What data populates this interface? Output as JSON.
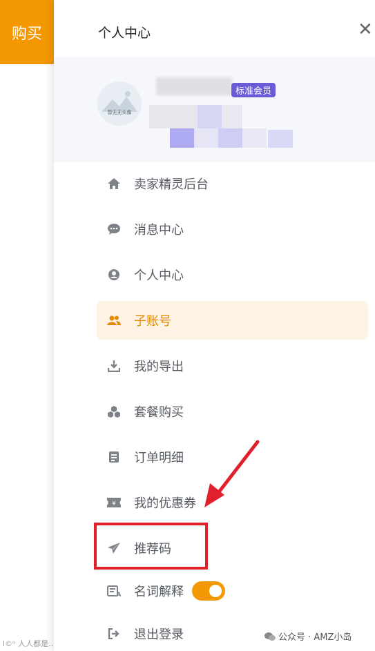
{
  "left_panel": {
    "buy_label": "购买",
    "watermark": "l©ᵒ 人人都是…"
  },
  "drawer": {
    "title": "个人中心",
    "close_symbol": "✕",
    "profile": {
      "member_badge": "标准会员",
      "avatar_text": "暂无无头像"
    },
    "menu": [
      {
        "label": "卖家精灵后台",
        "icon": "home-icon"
      },
      {
        "label": "消息中心",
        "icon": "chat-icon"
      },
      {
        "label": "个人中心",
        "icon": "user-circle-icon"
      },
      {
        "label": "子账号",
        "icon": "users-icon",
        "active": true
      },
      {
        "label": "我的导出",
        "icon": "download-icon"
      },
      {
        "label": "套餐购买",
        "icon": "boxes-icon"
      },
      {
        "label": "订单明细",
        "icon": "document-icon"
      },
      {
        "label": "我的优惠券",
        "icon": "ticket-icon"
      },
      {
        "label": "推荐码",
        "icon": "paper-plane-icon"
      },
      {
        "label": "名词解释",
        "icon": "glossary-icon",
        "toggle_on": true
      },
      {
        "label": "退出登录",
        "icon": "logout-icon"
      }
    ]
  },
  "footer": {
    "watermark": "公众号 · AMZ小岛"
  },
  "colors": {
    "accent": "#f39800",
    "active_bg": "#fdf2e3",
    "badge": "#6b5bd6",
    "annotation": "#e0212c"
  }
}
